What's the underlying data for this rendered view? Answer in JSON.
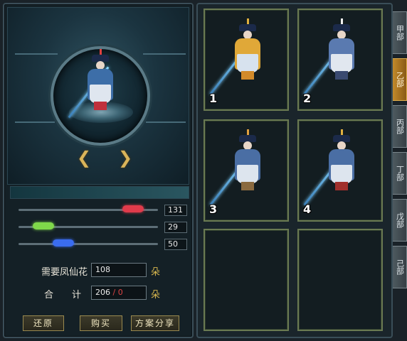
{
  "left": {
    "sliders": [
      {
        "value": "131",
        "color": "#e03b4b",
        "level": 0.82
      },
      {
        "value": "29",
        "color": "#7fd84a",
        "level": 0.18
      },
      {
        "value": "50",
        "color": "#3a6cf0",
        "level": 0.32
      }
    ],
    "need_label": "需要凤仙花",
    "need_value": "108",
    "need_unit": "朵",
    "total_label": "合　　计",
    "total_value": "206",
    "total_slash": "/",
    "total_limit": "0",
    "total_unit": "朵",
    "buttons": {
      "reset": "还原",
      "buy": "购买",
      "share": "方案分享"
    }
  },
  "slots": [
    "1",
    "2",
    "3",
    "4"
  ],
  "tabs": [
    "甲部",
    "乙部",
    "丙部",
    "丁部",
    "戊部",
    "己部"
  ],
  "active_tab": 1
}
